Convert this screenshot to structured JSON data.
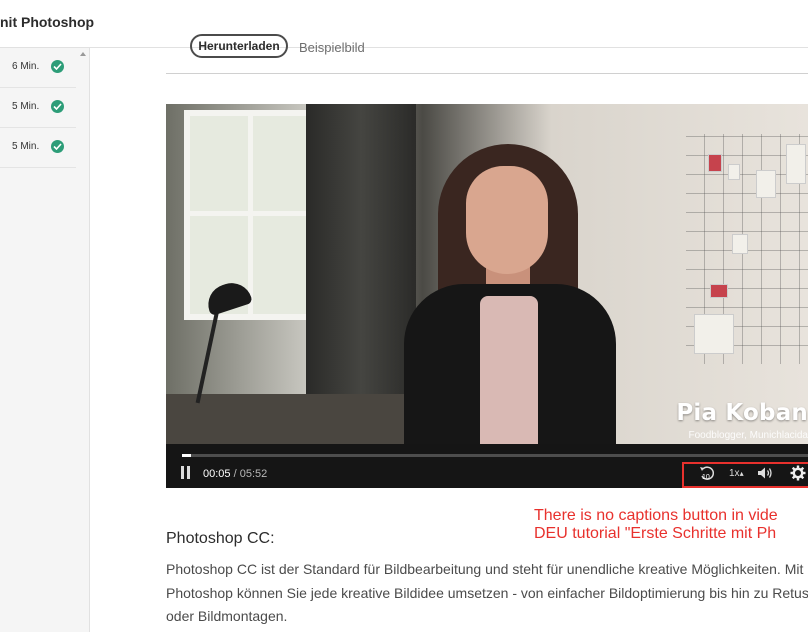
{
  "header": {
    "title": "nit Photoshop"
  },
  "sidebar": {
    "items": [
      {
        "duration": "6 Min.",
        "completed": true
      },
      {
        "duration": "5 Min.",
        "completed": true
      },
      {
        "duration": "5 Min.",
        "completed": true
      }
    ]
  },
  "tabs": [
    {
      "label": "Herunterladen",
      "active": true
    },
    {
      "label": "Beispielbild",
      "active": false
    }
  ],
  "video": {
    "presenter_name": "Pia Koban",
    "presenter_role": "Foodblogger, Munichlacida",
    "current_time": "00:05",
    "time_separator": " / ",
    "duration": "05:52",
    "progress_fraction": 0.015,
    "skip_back_seconds": "10",
    "speed": "1x",
    "speed_caret": "▴"
  },
  "annotation": {
    "line1": "There is no captions button in vide",
    "line2": "DEU tutorial \"Erste Schritte mit Ph"
  },
  "content": {
    "section_title": "Photoshop CC:",
    "lines": [
      "Photoshop CC ist der Standard für Bildbearbeitung und steht für unendliche kreative Möglichkeiten. Mit",
      "Photoshop können Sie jede kreative Bildidee umsetzen - von einfacher Bildoptimierung bis hin zu Retusche",
      "oder Bildmontagen."
    ]
  },
  "colors": {
    "check_green": "#2d9d78",
    "annotation_red": "#e8312d",
    "player_bar": "#151515"
  }
}
